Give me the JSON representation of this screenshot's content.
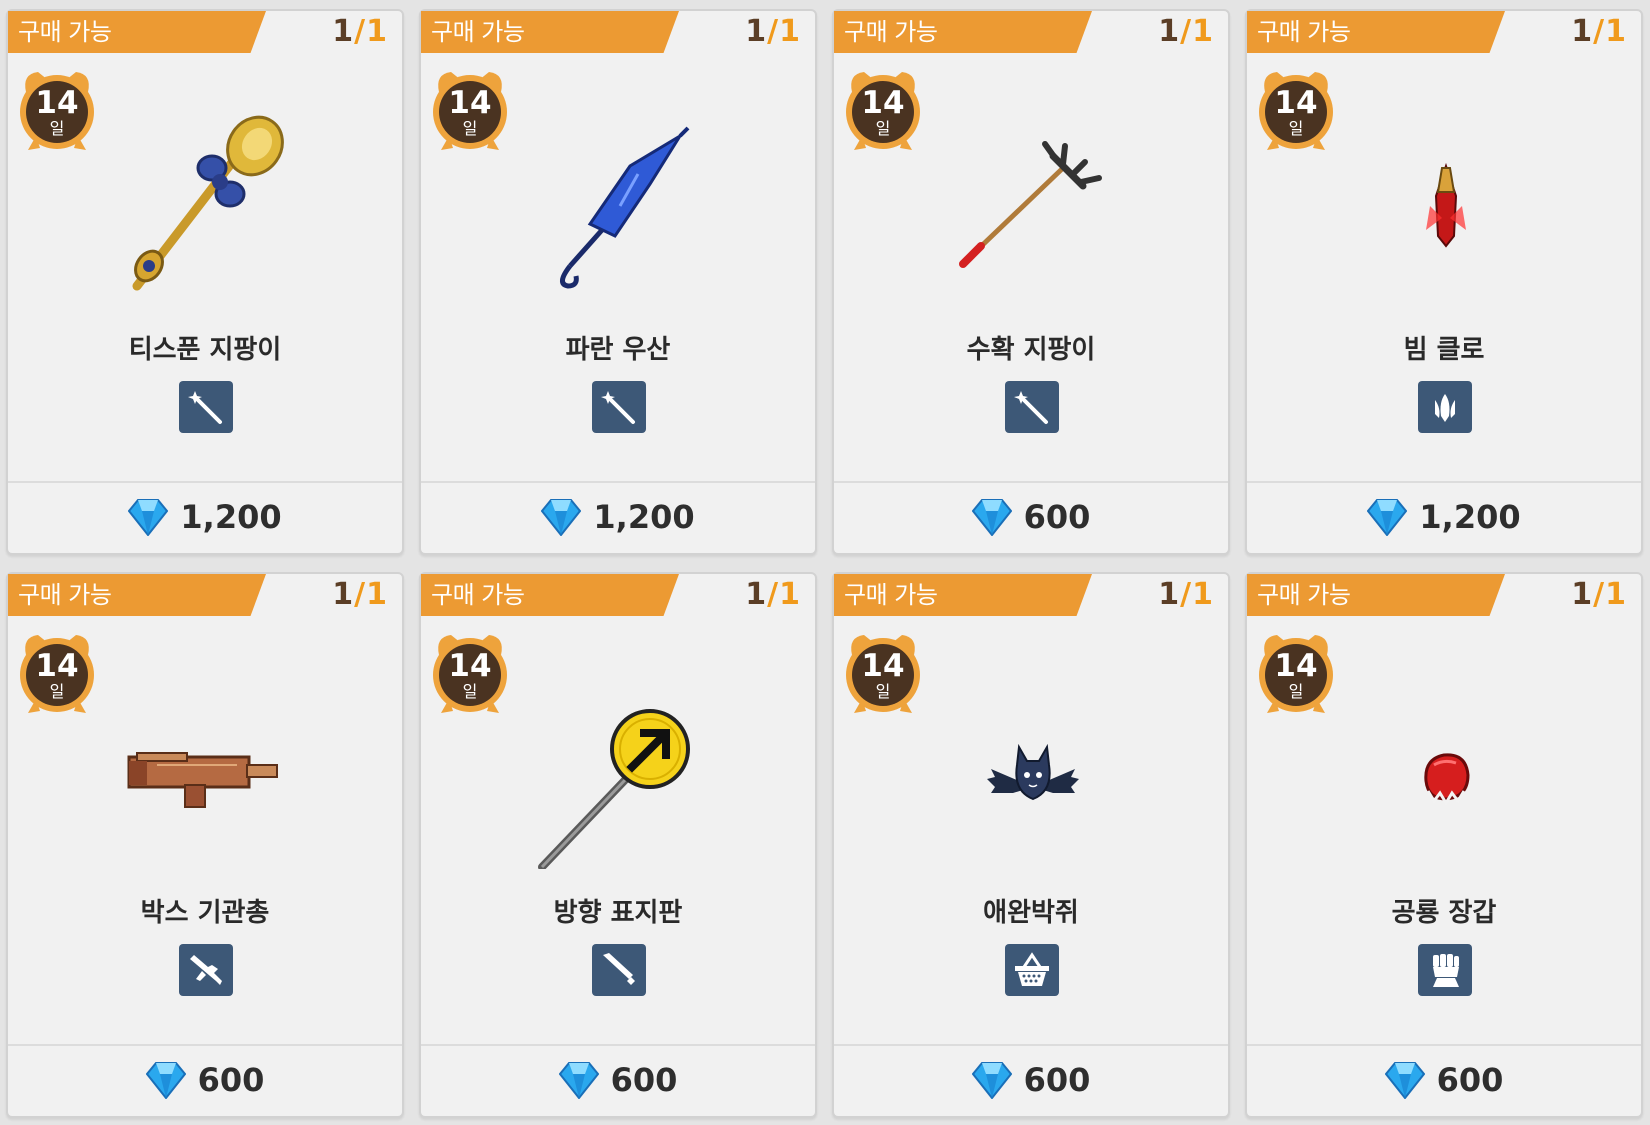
{
  "cards": [
    {
      "status": "구매 가능",
      "qty_current": "1",
      "qty_slash": "/",
      "qty_max": "1",
      "duration": "14",
      "duration_unit": "일",
      "name": "티스푼 지팡이",
      "category_icon": "wand-icon",
      "item_icon": "teaspoon-staff-icon",
      "price": "1,200",
      "currency_icon": "diamond-gem-icon"
    },
    {
      "status": "구매 가능",
      "qty_current": "1",
      "qty_slash": "/",
      "qty_max": "1",
      "duration": "14",
      "duration_unit": "일",
      "name": "파란 우산",
      "category_icon": "wand-icon",
      "item_icon": "blue-umbrella-icon",
      "price": "1,200",
      "currency_icon": "diamond-gem-icon"
    },
    {
      "status": "구매 가능",
      "qty_current": "1",
      "qty_slash": "/",
      "qty_max": "1",
      "duration": "14",
      "duration_unit": "일",
      "name": "수확 지팡이",
      "category_icon": "wand-icon",
      "item_icon": "harvest-rake-icon",
      "price": "600",
      "currency_icon": "diamond-gem-icon"
    },
    {
      "status": "구매 가능",
      "qty_current": "1",
      "qty_slash": "/",
      "qty_max": "1",
      "duration": "14",
      "duration_unit": "일",
      "name": "빔 클로",
      "category_icon": "claw-icon",
      "item_icon": "beam-claw-icon",
      "price": "1,200",
      "currency_icon": "diamond-gem-icon"
    },
    {
      "status": "구매 가능",
      "qty_current": "1",
      "qty_slash": "/",
      "qty_max": "1",
      "duration": "14",
      "duration_unit": "일",
      "name": "박스 기관총",
      "category_icon": "gun-icon",
      "item_icon": "box-machine-gun-icon",
      "price": "600",
      "currency_icon": "diamond-gem-icon"
    },
    {
      "status": "구매 가능",
      "qty_current": "1",
      "qty_slash": "/",
      "qty_max": "1",
      "duration": "14",
      "duration_unit": "일",
      "name": "방향 표지판",
      "category_icon": "sword-icon",
      "item_icon": "direction-sign-icon",
      "price": "600",
      "currency_icon": "diamond-gem-icon"
    },
    {
      "status": "구매 가능",
      "qty_current": "1",
      "qty_slash": "/",
      "qty_max": "1",
      "duration": "14",
      "duration_unit": "일",
      "name": "애완박쥐",
      "category_icon": "basket-icon",
      "item_icon": "pet-bat-icon",
      "price": "600",
      "currency_icon": "diamond-gem-icon"
    },
    {
      "status": "구매 가능",
      "qty_current": "1",
      "qty_slash": "/",
      "qty_max": "1",
      "duration": "14",
      "duration_unit": "일",
      "name": "공룡 장갑",
      "category_icon": "fist-icon",
      "item_icon": "dinosaur-glove-icon",
      "price": "600",
      "currency_icon": "diamond-gem-icon"
    }
  ],
  "colors": {
    "status_tag": "#ec9a33",
    "category_bg": "#3d5877",
    "badge_bg": "#4a3321",
    "badge_ring": "#eea33c",
    "qty_accent": "#f09a1c"
  }
}
